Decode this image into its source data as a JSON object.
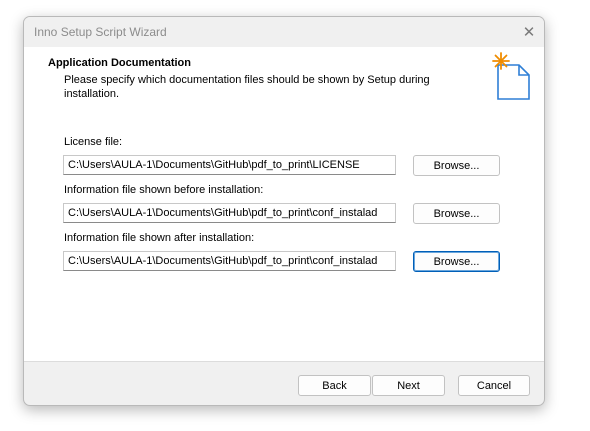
{
  "window": {
    "title": "Inno Setup Script Wizard",
    "close_glyph": "✕"
  },
  "page": {
    "heading": "Application Documentation",
    "subtitle": "Please specify which documentation files should be shown by Setup during installation."
  },
  "fields": {
    "license": {
      "label": "License file:",
      "value": "C:\\Users\\AULA-1\\Documents\\GitHub\\pdf_to_print\\LICENSE",
      "browse_label": "Browse..."
    },
    "before": {
      "label": "Information file shown before installation:",
      "value": "C:\\Users\\AULA-1\\Documents\\GitHub\\pdf_to_print\\conf_instalad",
      "browse_label": "Browse..."
    },
    "after": {
      "label": "Information file shown after installation:",
      "value": "C:\\Users\\AULA-1\\Documents\\GitHub\\pdf_to_print\\conf_instalad",
      "browse_label": "Browse..."
    }
  },
  "footer": {
    "back_label": "Back",
    "next_label": "Next",
    "cancel_label": "Cancel"
  },
  "colors": {
    "accent": "#005fb8",
    "wizard_icon_star": "#f08c00",
    "wizard_icon_page": "#2e7fd6"
  },
  "icons": {
    "close": "close-icon",
    "wizard": "wizard-document-icon"
  }
}
